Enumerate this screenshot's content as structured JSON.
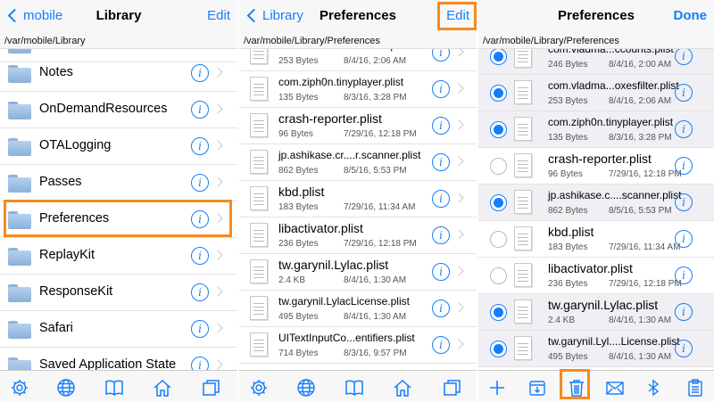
{
  "panel1": {
    "back_label": "mobile",
    "title": "Library",
    "right_label": "Edit",
    "path": "/var/mobile/Library",
    "partial_top": "News",
    "items": [
      {
        "name": "Notes"
      },
      {
        "name": "OnDemandResources"
      },
      {
        "name": "OTALogging"
      },
      {
        "name": "Passes"
      },
      {
        "name": "Preferences"
      },
      {
        "name": "ReplayKit"
      },
      {
        "name": "ResponseKit"
      },
      {
        "name": "Safari"
      },
      {
        "name": "Saved Application State"
      }
    ]
  },
  "panel2": {
    "back_label": "Library",
    "title": "Preferences",
    "right_label": "Edit",
    "path": "/var/mobile/Library/Preferences",
    "partial_top": {
      "name": "com.vladma...oxesfilter.plist",
      "size": "253 Bytes",
      "date": "8/4/16, 2:06 AM"
    },
    "files": [
      {
        "name": "com.ziph0n.tinyplayer.plist",
        "size": "135 Bytes",
        "date": "8/3/16, 3:28 PM"
      },
      {
        "name": "crash-reporter.plist",
        "size": "96 Bytes",
        "date": "7/29/16, 12:18 PM"
      },
      {
        "name": "jp.ashikase.cr....r.scanner.plist",
        "size": "862 Bytes",
        "date": "8/5/16, 5:53 PM"
      },
      {
        "name": "kbd.plist",
        "size": "183 Bytes",
        "date": "7/29/16, 11:34 AM"
      },
      {
        "name": "libactivator.plist",
        "size": "236 Bytes",
        "date": "7/29/16, 12:18 PM"
      },
      {
        "name": "tw.garynil.Lylac.plist",
        "size": "2.4 KB",
        "date": "8/4/16, 1:30 AM"
      },
      {
        "name": "tw.garynil.LylacLicense.plist",
        "size": "495 Bytes",
        "date": "8/4/16, 1:30 AM"
      },
      {
        "name": "UITextInputCo...entifiers.plist",
        "size": "714 Bytes",
        "date": "8/3/16, 9:57 PM"
      }
    ]
  },
  "panel3": {
    "title": "Preferences",
    "right_label": "Done",
    "path": "/var/mobile/Library/Preferences",
    "files": [
      {
        "name": "com.vladma...ccounts.plist",
        "size": "246 Bytes",
        "date": "8/4/16, 2:00 AM",
        "selected": true
      },
      {
        "name": "com.vladma...oxesfilter.plist",
        "size": "253 Bytes",
        "date": "8/4/16, 2:06 AM",
        "selected": true
      },
      {
        "name": "com.ziph0n.tinyplayer.plist",
        "size": "135 Bytes",
        "date": "8/3/16, 3:28 PM",
        "selected": true
      },
      {
        "name": "crash-reporter.plist",
        "size": "96 Bytes",
        "date": "7/29/16, 12:18 PM",
        "selected": false
      },
      {
        "name": "jp.ashikase.c....scanner.plist",
        "size": "862 Bytes",
        "date": "8/5/16, 5:53 PM",
        "selected": true
      },
      {
        "name": "kbd.plist",
        "size": "183 Bytes",
        "date": "7/29/16, 11:34 AM",
        "selected": false
      },
      {
        "name": "libactivator.plist",
        "size": "236 Bytes",
        "date": "7/29/16, 12:18 PM",
        "selected": false
      },
      {
        "name": "tw.garynil.Lylac.plist",
        "size": "2.4 KB",
        "date": "8/4/16, 1:30 AM",
        "selected": true
      },
      {
        "name": "tw.garynil.Lyl....License.plist",
        "size": "495 Bytes",
        "date": "8/4/16, 1:30 AM",
        "selected": true
      }
    ]
  },
  "colors": {
    "accent": "#147efb",
    "highlight": "#f68a1f"
  },
  "toolbar_icons_main": [
    "gear-icon",
    "globe-icon",
    "book-icon",
    "home-icon",
    "windows-icon"
  ],
  "toolbar_icons_edit": [
    "plus-icon",
    "archive-icon",
    "trash-icon",
    "mail-icon",
    "bluetooth-icon",
    "clipboard-icon"
  ]
}
